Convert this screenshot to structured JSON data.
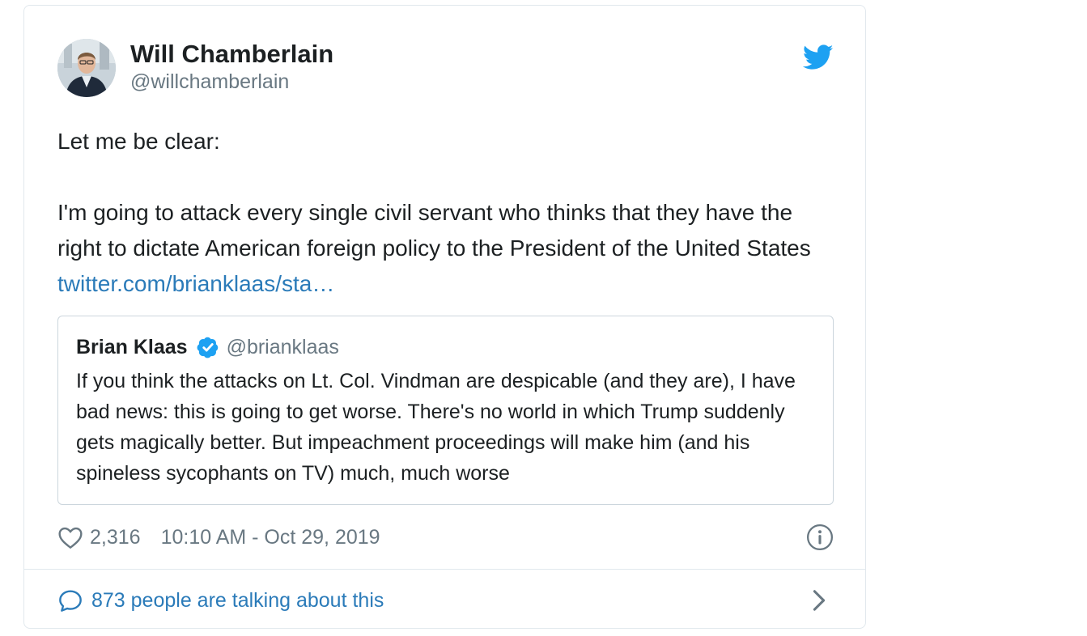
{
  "author": {
    "name": "Will Chamberlain",
    "handle": "@willchamberlain"
  },
  "tweet": {
    "line1": "Let me be clear:",
    "body": "I'm going to attack every single civil servant who thinks that they have the right to dictate American foreign policy to the President of the United States ",
    "link": "twitter.com/brianklaas/sta…"
  },
  "quote": {
    "name": "Brian Klaas",
    "handle": "@brianklaas",
    "text": "If you think the attacks on Lt. Col. Vindman are despicable (and they are), I have bad news: this is going to get worse. There's no world in which Trump suddenly gets magically better. But impeachment proceedings will make him (and his spineless sycophants on TV) much, much worse"
  },
  "meta": {
    "likes": "2,316",
    "timestamp": "10:10 AM - Oct 29, 2019"
  },
  "footer": {
    "talking": "873 people are talking about this"
  },
  "icons": {
    "bird": "twitter-bird-icon",
    "verified": "verified-badge-icon",
    "heart": "heart-icon",
    "info": "info-icon",
    "bubble": "comment-bubble-icon",
    "chevron": "chevron-right-icon"
  },
  "colors": {
    "brand": "#1da1f2",
    "link": "#2b7bb9",
    "muted": "#697882",
    "text": "#1c2022",
    "border": "#e1e8ed"
  }
}
